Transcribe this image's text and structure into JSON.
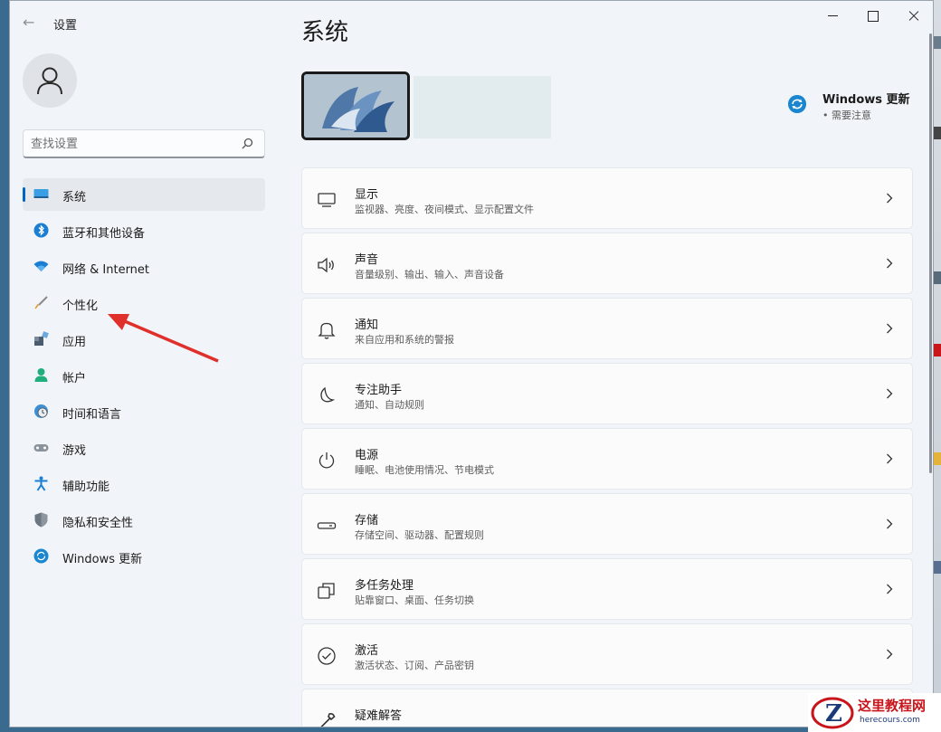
{
  "window": {
    "back_symbol": "←",
    "app_title": "设置"
  },
  "search": {
    "placeholder": "查找设置"
  },
  "sidebar": {
    "items": [
      {
        "label": "系统",
        "selected": true
      },
      {
        "label": "蓝牙和其他设备"
      },
      {
        "label": "网络 & Internet"
      },
      {
        "label": "个性化"
      },
      {
        "label": "应用"
      },
      {
        "label": "帐户"
      },
      {
        "label": "时间和语言"
      },
      {
        "label": "游戏"
      },
      {
        "label": "辅助功能"
      },
      {
        "label": "隐私和安全性"
      },
      {
        "label": "Windows 更新"
      }
    ]
  },
  "main": {
    "title": "系统",
    "windows_update": {
      "title": "Windows 更新",
      "status": "需要注意"
    },
    "cards": [
      {
        "title": "显示",
        "subtitle": "监视器、亮度、夜间模式、显示配置文件",
        "icon": "display-icon"
      },
      {
        "title": "声音",
        "subtitle": "音量级别、输出、输入、声音设备",
        "icon": "speaker-icon"
      },
      {
        "title": "通知",
        "subtitle": "来自应用和系统的警报",
        "icon": "bell-icon"
      },
      {
        "title": "专注助手",
        "subtitle": "通知、自动规则",
        "icon": "moon-icon"
      },
      {
        "title": "电源",
        "subtitle": "睡眠、电池使用情况、节电模式",
        "icon": "power-icon"
      },
      {
        "title": "存储",
        "subtitle": "存储空间、驱动器、配置规则",
        "icon": "storage-icon"
      },
      {
        "title": "多任务处理",
        "subtitle": "贴靠窗口、桌面、任务切换",
        "icon": "multitask-icon"
      },
      {
        "title": "激活",
        "subtitle": "激活状态、订阅、产品密钥",
        "icon": "check-circle-icon"
      },
      {
        "title": "疑难解答",
        "subtitle": "",
        "icon": "wrench-icon"
      }
    ]
  },
  "watermark": {
    "name": "这里教程网",
    "url": "herecours.com"
  },
  "colors": {
    "accent": "#0067c0",
    "arrow": "#e0302c",
    "window_bg": "#f1f4f8"
  }
}
